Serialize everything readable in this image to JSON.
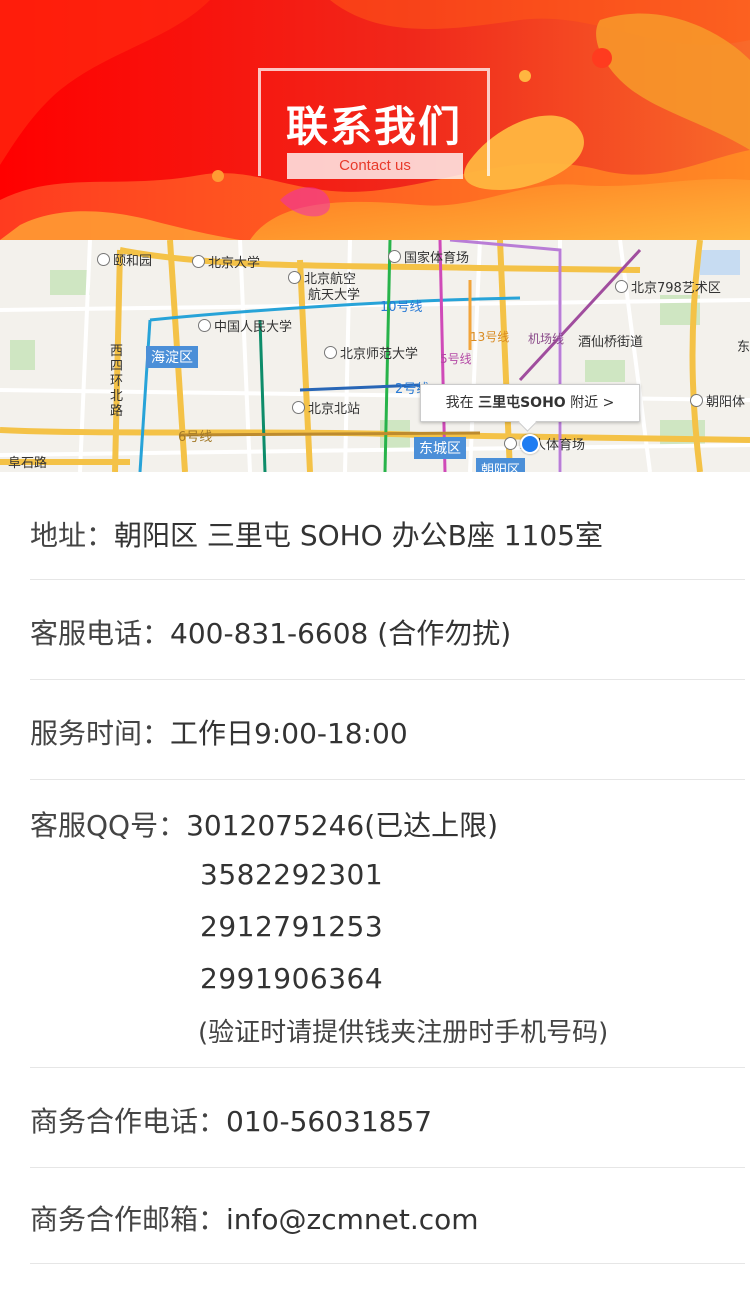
{
  "banner": {
    "title": "联系我们",
    "subtitle": "Contact us",
    "colors": {
      "red": "#ee1c1c",
      "orange": "#f5a233"
    }
  },
  "map": {
    "labels": [
      {
        "text": "颐和园",
        "poi": true
      },
      {
        "text": "北京大学",
        "poi": true
      },
      {
        "text": "国家体育场",
        "poi": true
      },
      {
        "text": "北京航空",
        "poi": true
      },
      {
        "text": "航天大学",
        "poi": false
      },
      {
        "text": "北京798艺术区",
        "poi": true
      },
      {
        "text": "10号线",
        "poi": false
      },
      {
        "text": "中国人民大学",
        "poi": true
      },
      {
        "text": "海淀区",
        "poi": false
      },
      {
        "text": "北京师范大学",
        "poi": true
      },
      {
        "text": "酒仙桥街道",
        "poi": false
      },
      {
        "text": "西四环北路",
        "poi": false
      },
      {
        "text": "2号线",
        "poi": false
      },
      {
        "text": "北京北站",
        "poi": true
      },
      {
        "text": "朝阳体",
        "poi": true
      },
      {
        "text": "6号线",
        "poi": false
      },
      {
        "text": "东城区",
        "poi": false
      },
      {
        "text": "工人体育场",
        "poi": true
      },
      {
        "text": "阜石路",
        "poi": false
      },
      {
        "text": "朝阳区",
        "poi": false
      },
      {
        "text": "5号线",
        "poi": false
      },
      {
        "text": "13号线",
        "poi": false
      },
      {
        "text": "机场线",
        "poi": false
      },
      {
        "text": "东",
        "poi": false
      }
    ],
    "bubble": {
      "prefix": "我在",
      "place": "三里屯SOHO",
      "suffix": "附近 >"
    }
  },
  "contact": {
    "address": {
      "label": "地址：",
      "value": "朝阳区 三里屯 SOHO 办公B座 1105室"
    },
    "phone": {
      "label": "客服电话：",
      "value": "400-831-6608 (合作勿扰)"
    },
    "hours": {
      "label": "服务时间：",
      "value": "工作日9:00-18:00"
    },
    "qq": {
      "label": "客服QQ号：",
      "first": "3012075246",
      "first_note": "(已达上限)",
      "others": [
        "3582292301",
        "2912791253",
        "2991906364"
      ],
      "note": "(验证时请提供钱夹注册时手机号码)"
    },
    "biz_phone": {
      "label": "商务合作电话：",
      "value": "010-56031857"
    },
    "biz_email": {
      "label": "商务合作邮箱：",
      "value": "info@zcmnet.com"
    }
  }
}
